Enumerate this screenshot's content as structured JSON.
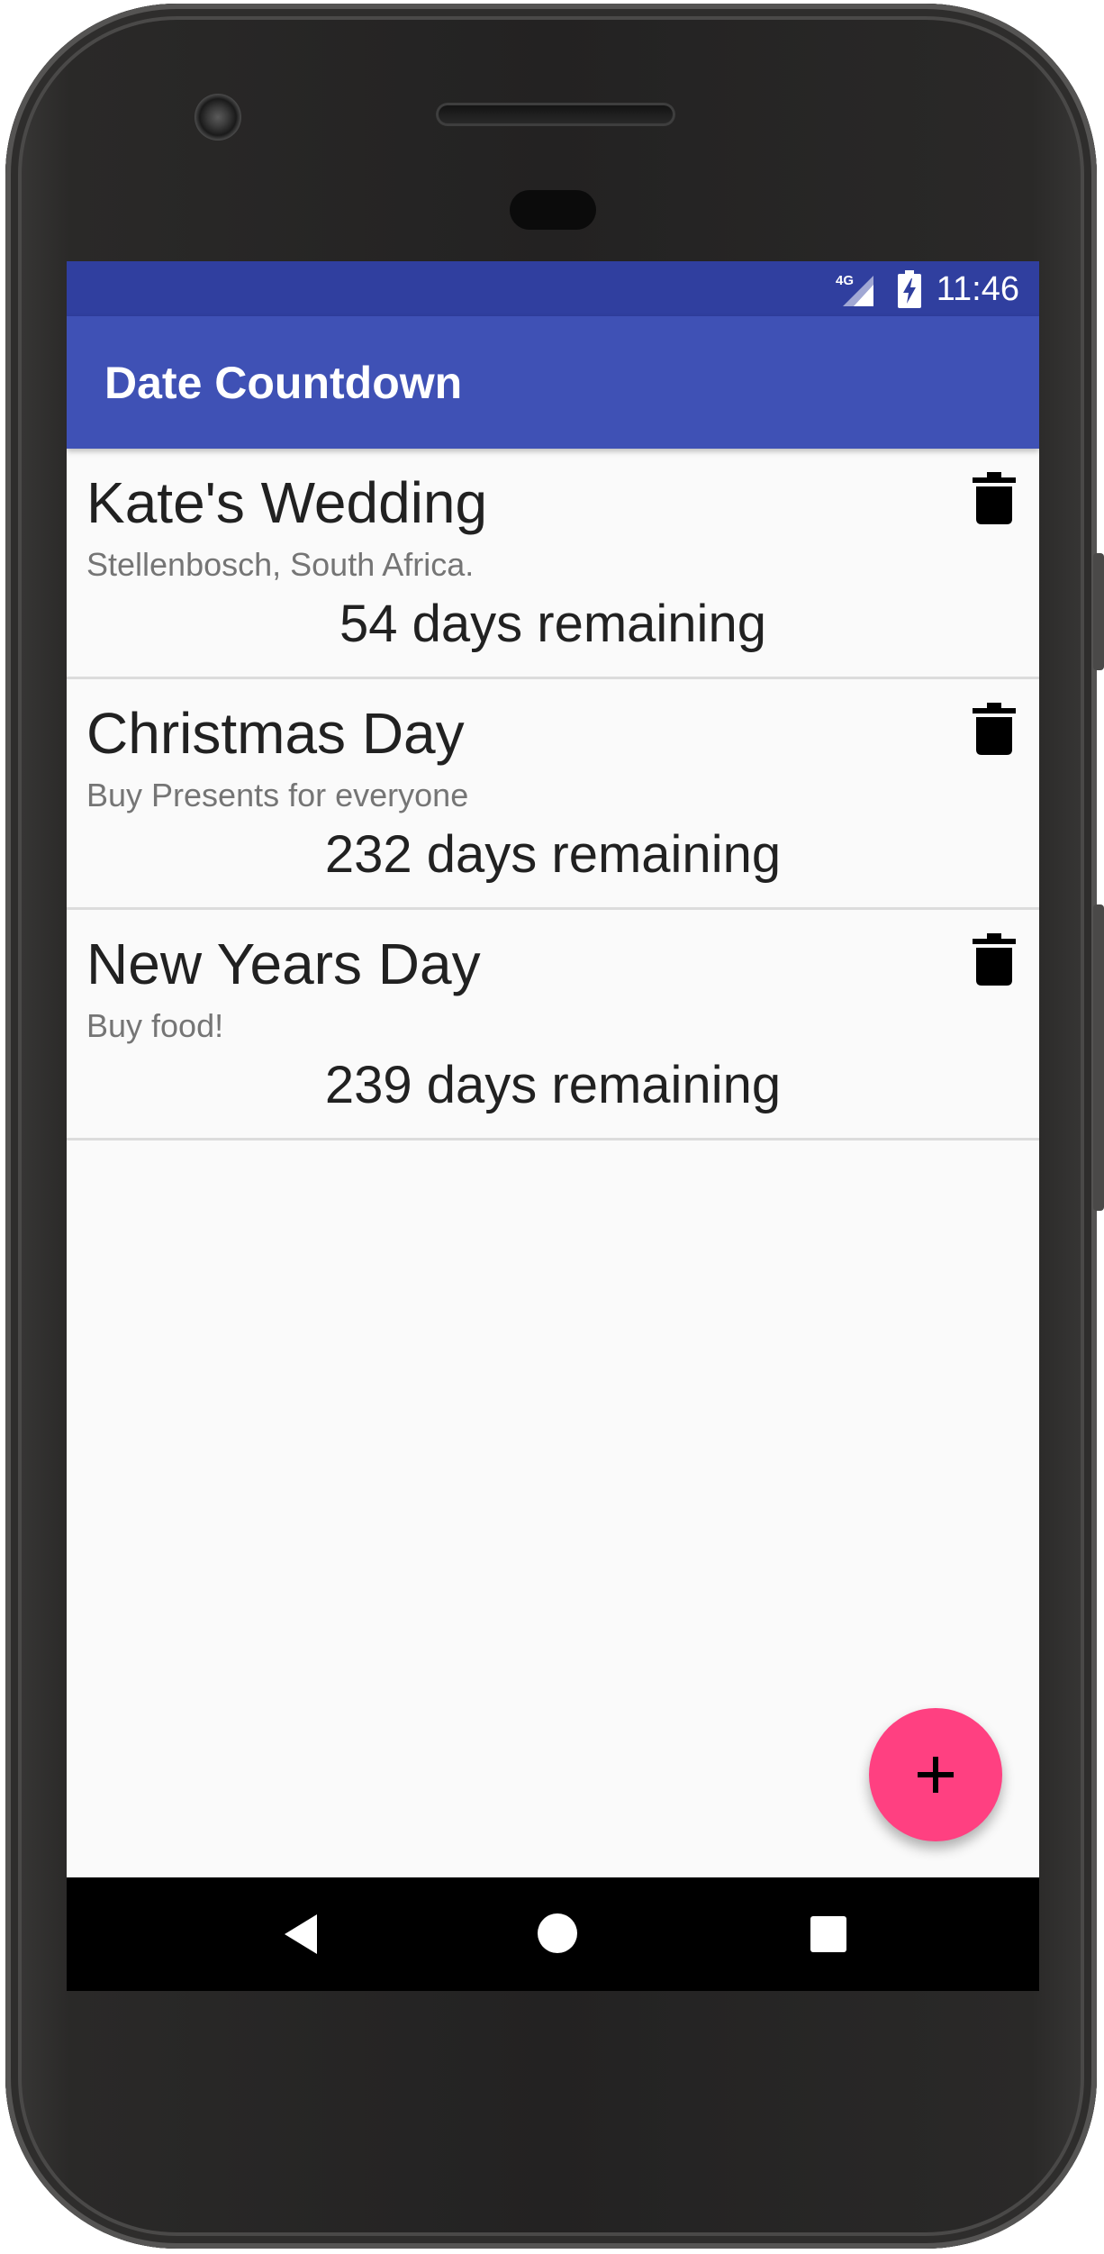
{
  "status_bar": {
    "network": "4G",
    "time": "11:46"
  },
  "app_bar": {
    "title": "Date Countdown"
  },
  "countdowns": [
    {
      "title": "Kate's Wedding",
      "note": "Stellenbosch, South Africa.",
      "remaining": "54 days remaining"
    },
    {
      "title": "Christmas Day",
      "note": "Buy Presents for everyone",
      "remaining": "232 days remaining"
    },
    {
      "title": "New Years Day",
      "note": "Buy food!",
      "remaining": "239 days remaining"
    }
  ],
  "icons": {
    "delete": "trash-icon",
    "add": "plus-icon",
    "nav_back": "back-triangle-icon",
    "nav_home": "home-circle-icon",
    "nav_recents": "recents-square-icon"
  },
  "colors": {
    "status_bar": "#303f9f",
    "app_bar": "#3f51b5",
    "fab": "#ff4081",
    "background": "#fafafa"
  }
}
